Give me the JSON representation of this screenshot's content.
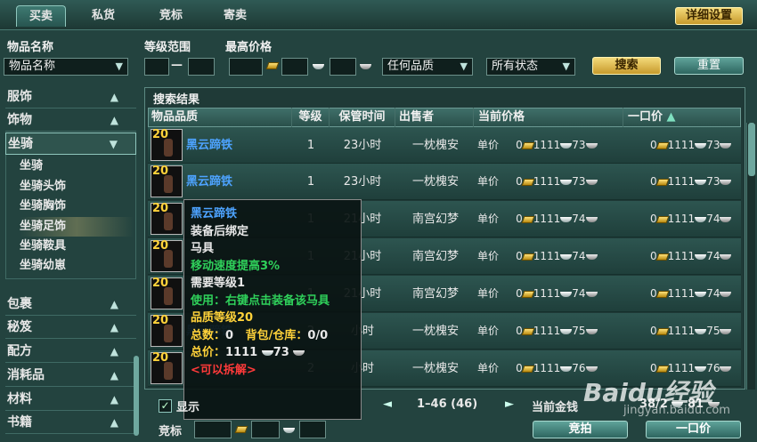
{
  "tabs": [
    {
      "label": "买卖"
    },
    {
      "label": "私货"
    },
    {
      "label": "竞标"
    },
    {
      "label": "寄卖"
    }
  ],
  "detail_settings": "详细设置",
  "filters": {
    "item_name_label": "物品名称",
    "item_name_value": "物品名称",
    "level_range_label": "等级范围",
    "level_dash": "—",
    "max_price_label": "最高价格",
    "quality_value": "任何品质",
    "status_value": "所有状态",
    "search": "搜索",
    "reset": "重置"
  },
  "sidebar": {
    "categories_top": [
      "服饰",
      "饰物",
      "坐骑"
    ],
    "subitems": [
      "坐骑",
      "坐骑头饰",
      "坐骑胸饰",
      "坐骑足饰",
      "坐骑鞍具",
      "坐骑幼崽"
    ],
    "categories_bottom": [
      "包裹",
      "秘笈",
      "配方",
      "消耗品",
      "材料",
      "书籍"
    ],
    "selected_sub": "坐骑足饰"
  },
  "results": {
    "title": "搜索结果",
    "headers": {
      "quality": "物品品质",
      "level": "等级",
      "time": "保管时间",
      "seller": "出售者",
      "current": "当前价格",
      "buyout": "一口价",
      "sort_icon": "up-arrow"
    },
    "rows": [
      {
        "lv": "20",
        "name": "黑云蹄铁",
        "level": "1",
        "time": "23小时",
        "seller": "一枕槐安",
        "unit": "单价",
        "cg": "0",
        "cs": "1111",
        "cc": "73",
        "bg": "0",
        "bs": "1111",
        "bc": "73"
      },
      {
        "lv": "20",
        "name": "黑云蹄铁",
        "level": "1",
        "time": "23小时",
        "seller": "一枕槐安",
        "unit": "单价",
        "cg": "0",
        "cs": "1111",
        "cc": "73",
        "bg": "0",
        "bs": "1111",
        "bc": "73"
      },
      {
        "lv": "20",
        "name": "",
        "level": "1",
        "time": "21小时",
        "seller": "南宫幻梦",
        "unit": "单价",
        "cg": "0",
        "cs": "1111",
        "cc": "74",
        "bg": "0",
        "bs": "1111",
        "bc": "74"
      },
      {
        "lv": "20",
        "name": "",
        "level": "1",
        "time": "21小时",
        "seller": "南宫幻梦",
        "unit": "单价",
        "cg": "0",
        "cs": "1111",
        "cc": "74",
        "bg": "0",
        "bs": "1111",
        "bc": "74"
      },
      {
        "lv": "20",
        "name": "",
        "level": "1",
        "time": "21小时",
        "seller": "南宫幻梦",
        "unit": "单价",
        "cg": "0",
        "cs": "1111",
        "cc": "74",
        "bg": "0",
        "bs": "1111",
        "bc": "74"
      },
      {
        "lv": "20",
        "name": "黑云蹄铁",
        "level": "2",
        "time": "小时",
        "seller": "一枕槐安",
        "unit": "单价",
        "cg": "0",
        "cs": "1111",
        "cc": "75",
        "bg": "0",
        "bs": "1111",
        "bc": "75"
      },
      {
        "lv": "20",
        "name": "",
        "level": "2",
        "time": "小时",
        "seller": "一枕槐安",
        "unit": "单价",
        "cg": "0",
        "cs": "1111",
        "cc": "76",
        "bg": "0",
        "bs": "1111",
        "bc": "76"
      }
    ]
  },
  "tooltip": {
    "name": "黑云蹄铁",
    "bind": "装备后绑定",
    "type": "马具",
    "effect": "移动速度提高3%",
    "req": "需要等级1",
    "use": "使用：右键点击装备该马具",
    "quality": "品质等级20",
    "total_label": "总数：",
    "total": "0",
    "bag_label": "背包/仓库：",
    "bag": "0/0",
    "price_label": "总价：",
    "price_silver": "1111",
    "price_copper": "73",
    "split": "<可以拆解>"
  },
  "footer": {
    "show_label": "显示",
    "pages": "1–46 (46)",
    "prev": "◄",
    "next": "►",
    "money_label": "当前金钱",
    "money_silver": "38/2",
    "money_copper": "81",
    "bid_label": "竞标",
    "bid_btn": "竞拍",
    "buy_btn": "一口价"
  },
  "watermark": {
    "logo": "Baidu经验",
    "url": "jingyan.baidu.com"
  }
}
